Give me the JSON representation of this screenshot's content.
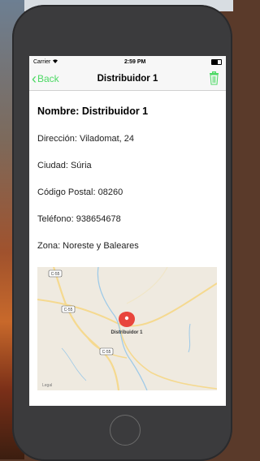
{
  "status_bar": {
    "carrier": "Carrier",
    "time": "2:59 PM"
  },
  "nav": {
    "back_label": "Back",
    "title": "Distribuidor 1"
  },
  "details": {
    "name": "Nombre: Distribuidor 1",
    "address": "Dirección: Viladomat, 24",
    "city": "Ciudad: Súria",
    "postal_code": "Código Postal: 08260",
    "phone": "Teléfono: 938654678",
    "zone": "Zona: Noreste y Baleares"
  },
  "map": {
    "road_labels": [
      "C-55",
      "C-55",
      "C-55"
    ],
    "pin_label": "Distribuidor 1",
    "legal": "Legal",
    "pin_color": "#e8453c"
  },
  "colors": {
    "accent": "#4cd964",
    "device": "#3b3b3d"
  },
  "icons": {
    "trash": "trash-icon",
    "back": "chevron-left-icon",
    "wifi": "wifi-icon"
  }
}
